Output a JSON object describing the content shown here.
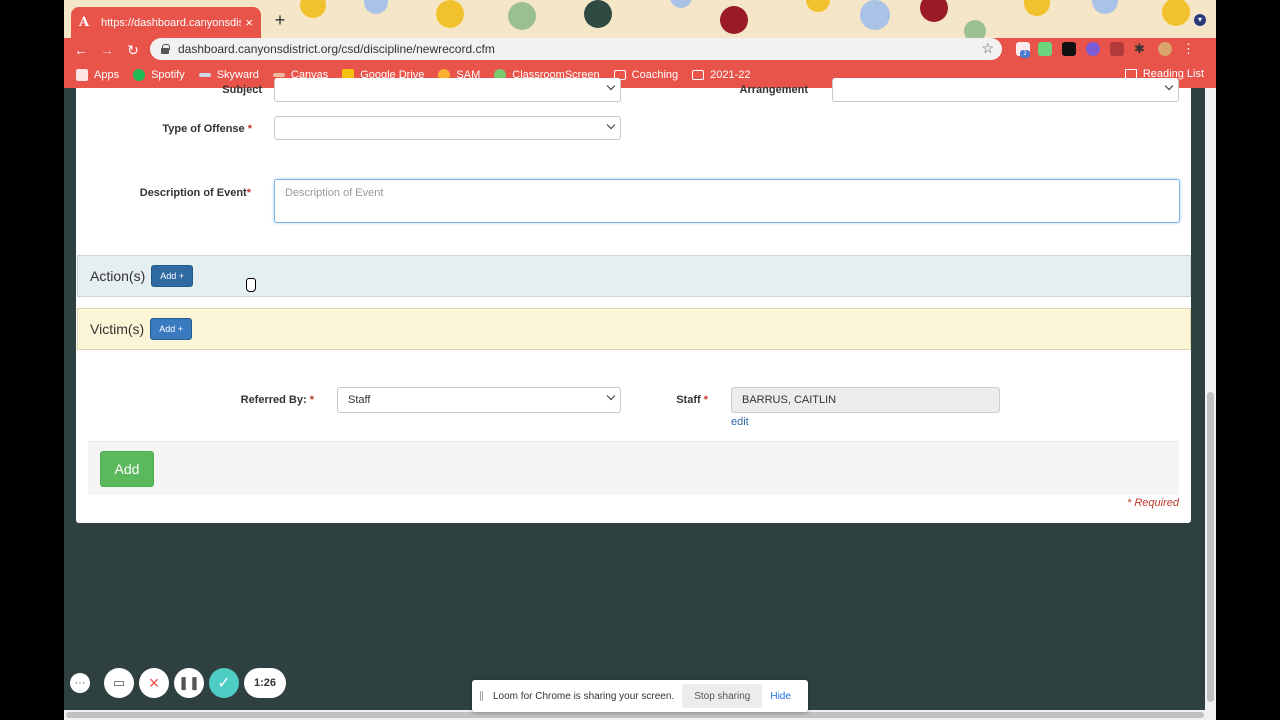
{
  "browser": {
    "tab_title": "https://dashboard.canyonsdistrict.org/csd/discipline/newrecord.cfm",
    "tab_favicon": "A",
    "tab_close": "×",
    "new_tab": "+",
    "url": "dashboard.canyonsdistrict.org/csd/discipline/newrecord.cfm",
    "back": "←",
    "forward": "→",
    "reload": "↻",
    "star": "☆",
    "ext_badge": "2",
    "menu": "⋮",
    "accent": "#e8534a"
  },
  "bookmarks": [
    {
      "label": "Apps",
      "icon": "apps-grid-icon",
      "color": "#ffffff"
    },
    {
      "label": "Spotify",
      "icon": "spotify-icon",
      "color": "#1db954"
    },
    {
      "label": "Skyward",
      "icon": "skyward-icon",
      "color": "#cfd8e6"
    },
    {
      "label": "Canvas",
      "icon": "canvas-icon",
      "color": "#f2b8a0"
    },
    {
      "label": "Google Drive",
      "icon": "drive-icon",
      "color": "#f4c20d"
    },
    {
      "label": "SAM",
      "icon": "sam-icon",
      "color": "#f9b233"
    },
    {
      "label": "ClassroomScreen",
      "icon": "classroomscreen-icon",
      "color": "#7bc96f"
    },
    {
      "label": "Coaching",
      "icon": "folder-icon",
      "color": "#ffffff"
    },
    {
      "label": "2021-22",
      "icon": "folder-icon",
      "color": "#ffffff"
    }
  ],
  "reading_list": "Reading List",
  "form": {
    "subject_label": "Subject",
    "arrangement_label": "Arrangement",
    "offense_label": "Type of Offense",
    "required_mark": "*",
    "description_label": "Description of Event",
    "description_placeholder": "Description of Event",
    "actions_title": "Action(s)",
    "victims_title": "Victim(s)",
    "add_small": "Add +",
    "referred_by_label": "Referred By:",
    "referred_by_value": "Staff",
    "staff_label": "Staff",
    "staff_value": "BARRUS, CAITLIN",
    "edit_link": "edit",
    "add_button": "Add",
    "required_note": "* Required"
  },
  "loom": {
    "more": "···",
    "timer": "1:26",
    "share_text": "Loom for Chrome is sharing your screen.",
    "stop_sharing": "Stop sharing",
    "hide": "Hide",
    "check_color": "#4ecdc4"
  }
}
